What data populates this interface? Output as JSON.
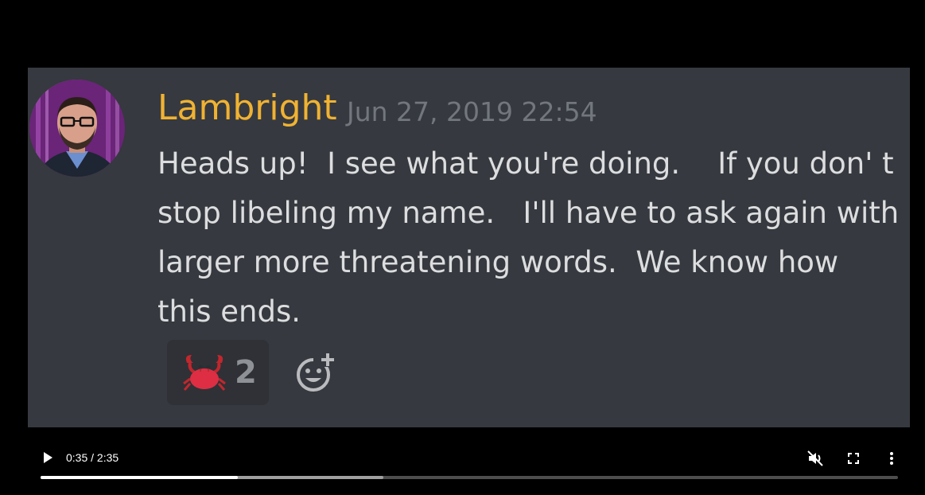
{
  "message": {
    "username": "Lambright",
    "timestamp": "Jun 27, 2019 22:54",
    "lines": [
      "Heads up!  I see what you're doing.    If you don' t",
      "stop libeling my name.   I'll have to ask again with",
      "larger more threatening words.  We know how",
      "this ends."
    ],
    "reaction": {
      "emoji": "crab-emoji",
      "count": "2"
    },
    "add_reaction_icon": "add-reaction-icon"
  },
  "player": {
    "time_display": "0:35 / 2:35",
    "progress_played": 0.23,
    "progress_buffered": 0.4,
    "icons": {
      "play": "play-icon",
      "mute": "muted-speaker-icon",
      "fullscreen": "fullscreen-icon",
      "more": "more-options-icon"
    }
  },
  "colors": {
    "username": "#f0b232",
    "timestamp": "#72767d",
    "message_text": "#dcddde",
    "background": "#36393f",
    "reaction_bg": "#2f3136"
  }
}
